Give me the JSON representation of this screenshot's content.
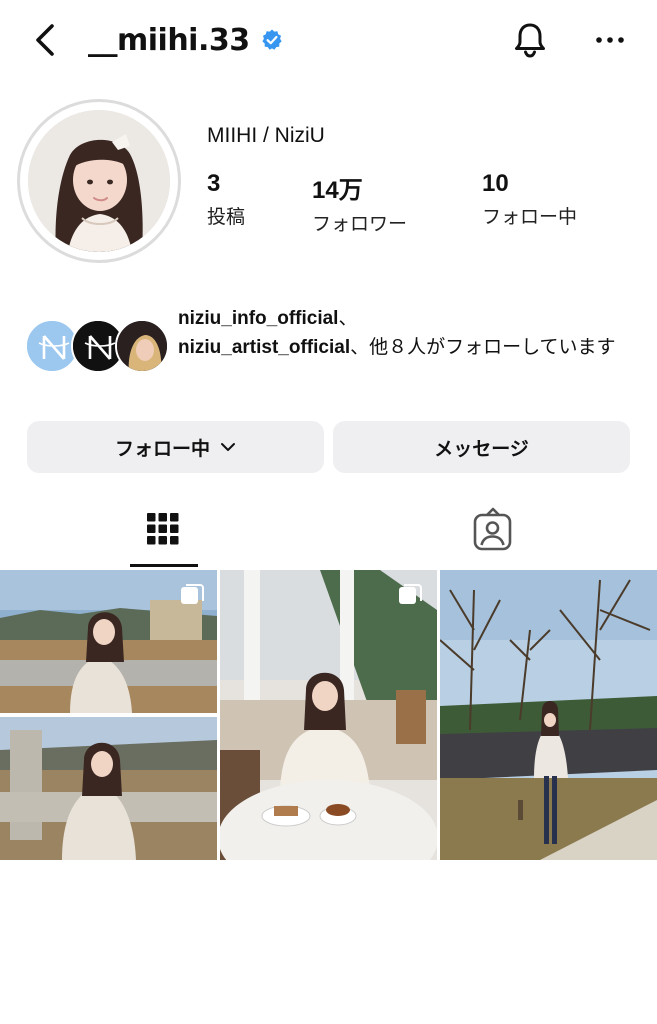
{
  "header": {
    "username": "__miihi.33",
    "back_icon": "chevron-left-icon",
    "verified_icon": "verified-badge-icon",
    "bell_icon": "bell-icon",
    "more_icon": "more-horizontal-icon"
  },
  "profile": {
    "display_name": "MIIHI / NiziU",
    "stats": [
      {
        "value": "3",
        "label": "投稿"
      },
      {
        "value": "14万",
        "label": "フォロワー"
      },
      {
        "value": "10",
        "label": "フォロー中"
      }
    ]
  },
  "followed_by": {
    "account_1": "niziu_info_official",
    "sep_1": "、",
    "account_2": "niziu_artist_official",
    "rest": "、他８人がフォローしています"
  },
  "actions": {
    "following_label": "フォロー中",
    "message_label": "メッセージ"
  },
  "tabs": {
    "grid_icon": "grid-icon",
    "tagged_icon": "tagged-user-icon",
    "active": "grid"
  },
  "colors": {
    "verified": "#3797f0",
    "button_bg": "#efeff2",
    "text": "#111111"
  },
  "posts": [
    {
      "type": "carousel",
      "scene": "riverside bridge, two stacked photos"
    },
    {
      "type": "carousel",
      "scene": "cafe terrace with tea and cake"
    },
    {
      "type": "single",
      "scene": "park path with bare trees"
    }
  ]
}
